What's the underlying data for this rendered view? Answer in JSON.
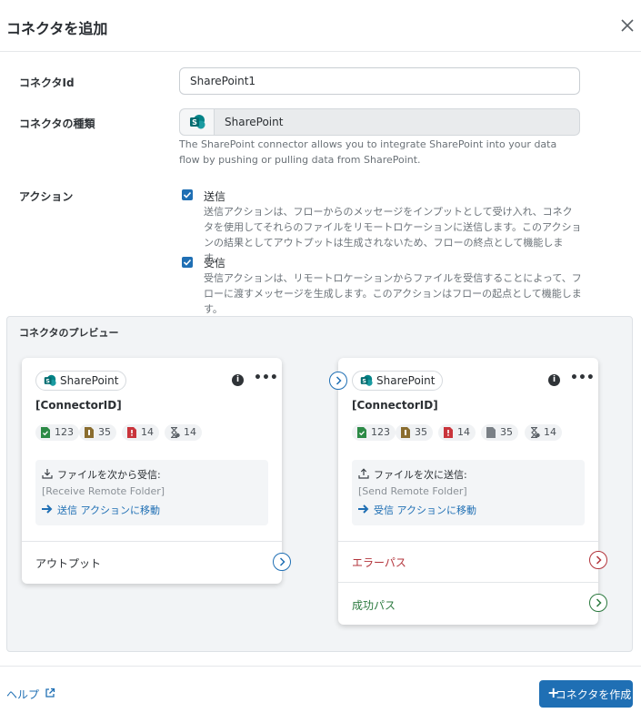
{
  "dialog": {
    "title": "コネクタを追加"
  },
  "form": {
    "connector_id_label": "コネクタId",
    "connector_id_value": "SharePoint1",
    "connector_type_label": "コネクタの種類",
    "connector_type_value": "SharePoint",
    "connector_type_description": "The SharePoint connector allows you to integrate SharePoint into your data flow by pushing or pulling data from SharePoint.",
    "action_label": "アクション",
    "actions": [
      {
        "label": "送信",
        "checked": true,
        "description": "送信アクションは、フローからのメッセージをインプットとして受け入れ、コネクタを使用してそれらのファイルをリモートロケーションに送信します。このアクションの結果としてアウトプットは生成されないため、フローの終点として機能します。"
      },
      {
        "label": "受信",
        "checked": true,
        "description": "受信アクションは、リモートロケーションからファイルを受信することによって、フローに渡すメッセージを生成します。このアクションはフローの起点として機能します。"
      }
    ]
  },
  "preview": {
    "title": "コネクタのプレビュー",
    "cards": [
      {
        "service": "SharePoint",
        "connector_id": "[ConnectorID]",
        "badges": [
          "123",
          "35",
          "14",
          "14"
        ],
        "box_label": "ファイルを次から受信:",
        "box_folder": "[Receive Remote Folder]",
        "box_link": "送信 アクションに移動",
        "output_label": "アウトプット"
      },
      {
        "service": "SharePoint",
        "connector_id": "[ConnectorID]",
        "badges": [
          "123",
          "35",
          "14",
          "35",
          "14"
        ],
        "box_label": "ファイルを次に送信:",
        "box_folder": "[Send Remote Folder]",
        "box_link": "受信 アクションに移動",
        "error_path_label": "エラーパス",
        "success_path_label": "成功パス"
      }
    ]
  },
  "footer": {
    "help_label": "ヘルプ",
    "create_label": "コネクタを作成"
  },
  "colors": {
    "accent": "#1f6fb4",
    "error": "#b3353c",
    "success": "#2c7a3f",
    "sharepoint": "#036c70"
  }
}
